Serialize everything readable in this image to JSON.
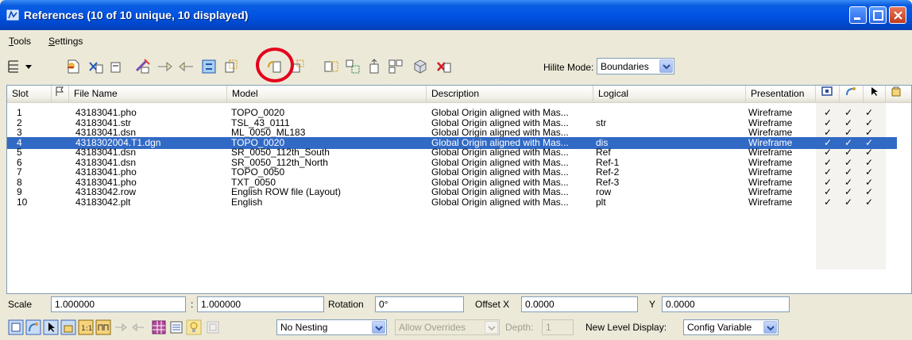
{
  "window": {
    "title": "References (10 of 10 unique, 10 displayed)"
  },
  "menu": [
    {
      "label": "Tools",
      "underline": "T",
      "rest": "ools"
    },
    {
      "label": "Settings",
      "underline": "S",
      "rest": "ettings"
    }
  ],
  "toolbar": {
    "hilite_label": "Hilite Mode:",
    "hilite_value": "Boundaries",
    "tools": [
      "list-view-icon",
      "attach-icon",
      "detach-icon",
      "clip-icon",
      "reload-icon",
      "move-icon",
      "copy-icon",
      "swap-icon",
      "scale-icon",
      "rotate-icon",
      "mirror-h-icon",
      "mirror-v-icon",
      "clip-boundary-icon",
      "clip-mask-icon",
      "3d-cube-icon",
      "delete-clip-icon"
    ]
  },
  "columns": [
    "Slot",
    "File Name",
    "Model",
    "Description",
    "Logical",
    "Presentation"
  ],
  "rows": [
    {
      "slot": "1",
      "file": "43183041.pho",
      "model": "TOPO_0020",
      "desc": "Global Origin aligned with Mas...",
      "logical": "",
      "pres": "Wireframe",
      "selected": false
    },
    {
      "slot": "2",
      "file": "43183041.str",
      "model": "TSL_43_0111",
      "desc": "Global Origin aligned with Mas...",
      "logical": "str",
      "pres": "Wireframe",
      "selected": false
    },
    {
      "slot": "3",
      "file": "43183041.dsn",
      "model": "ML_0050_ML183",
      "desc": "Global Origin aligned with Mas...",
      "logical": "",
      "pres": "Wireframe",
      "selected": false
    },
    {
      "slot": "4",
      "file": "4318302004.T1.dgn",
      "model": "TOPO_0020",
      "desc": "Global Origin aligned with Mas...",
      "logical": "dis",
      "pres": "Wireframe",
      "selected": true
    },
    {
      "slot": "5",
      "file": "43183041.dsn",
      "model": "SR_0050_112th_South",
      "desc": "Global Origin aligned with Mas...",
      "logical": "Ref",
      "pres": "Wireframe",
      "selected": false
    },
    {
      "slot": "6",
      "file": "43183041.dsn",
      "model": "SR_0050_112th_North",
      "desc": "Global Origin aligned with Mas...",
      "logical": "Ref-1",
      "pres": "Wireframe",
      "selected": false
    },
    {
      "slot": "7",
      "file": "43183041.pho",
      "model": "TOPO_0050",
      "desc": "Global Origin aligned with Mas...",
      "logical": "Ref-2",
      "pres": "Wireframe",
      "selected": false
    },
    {
      "slot": "8",
      "file": "43183041.pho",
      "model": "TXT_0050",
      "desc": "Global Origin aligned with Mas...",
      "logical": "Ref-3",
      "pres": "Wireframe",
      "selected": false
    },
    {
      "slot": "9",
      "file": "43183042.row",
      "model": "English ROW file (Layout)",
      "desc": "Global Origin aligned with Mas...",
      "logical": "row",
      "pres": "Wireframe",
      "selected": false
    },
    {
      "slot": "10",
      "file": "43183042.plt",
      "model": "English",
      "desc": "Global Origin aligned with Mas...",
      "logical": "plt",
      "pres": "Wireframe",
      "selected": false
    }
  ],
  "checkmark": "✓",
  "bottom": {
    "scale_label": "Scale",
    "scale_a": "1.000000",
    "scale_sep": ":",
    "scale_b": "1.000000",
    "rotation_label": "Rotation",
    "rotation_value": "0°",
    "offsetx_label": "Offset X",
    "offsetx_value": "0.0000",
    "y_label": "Y",
    "y_value": "0.0000",
    "nesting_value": "No Nesting",
    "overrides_value": "Allow Overrides",
    "depth_label": "Depth:",
    "depth_value": "1",
    "newlevel_label": "New Level Display:",
    "newlevel_value": "Config Variable"
  },
  "colors": {
    "title_blue": "#0054e3",
    "selection": "#316ac5",
    "highlight_circle": "#e5001b"
  }
}
